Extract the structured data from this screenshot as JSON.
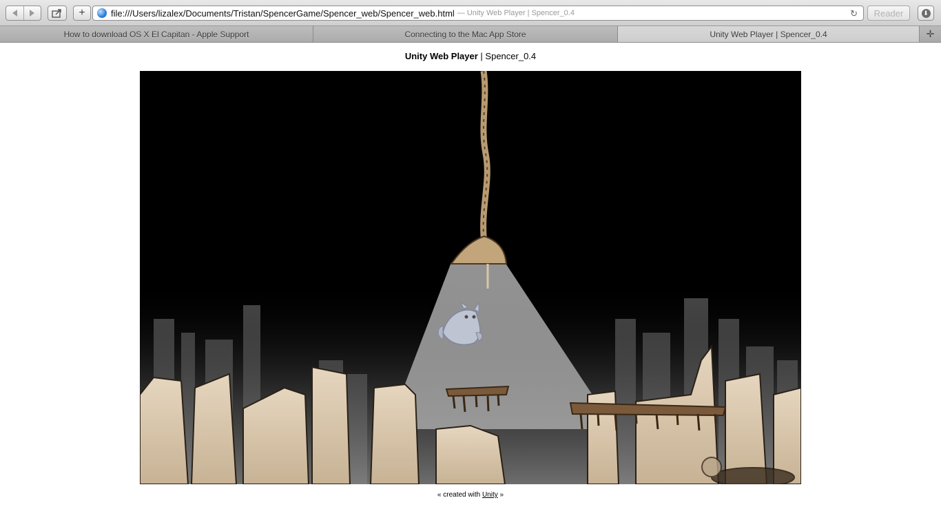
{
  "toolbar": {
    "url": "file:///Users/lizalex/Documents/Tristan/SpencerGame/Spencer_web/Spencer_web.html",
    "url_title": "— Unity Web Player | Spencer_0.4",
    "reader_label": "Reader",
    "add_label": "+"
  },
  "tabs": [
    {
      "label": "How to download OS X El Capitan - Apple Support",
      "active": false
    },
    {
      "label": "Connecting to the Mac App Store",
      "active": false
    },
    {
      "label": "Unity Web Player | Spencer_0.4",
      "active": true
    }
  ],
  "page": {
    "heading_bold": "Unity Web Player",
    "heading_sep": " | ",
    "heading_rest": "Spencer_0.4",
    "footer_prefix": "« created with ",
    "footer_link": "Unity",
    "footer_suffix": " »"
  },
  "game": {
    "background_color": "#000000",
    "scene": "rope hanging from top with lamp cone of light, ghostly owl-cat character, ruined city silhouettes, broken platforms"
  }
}
